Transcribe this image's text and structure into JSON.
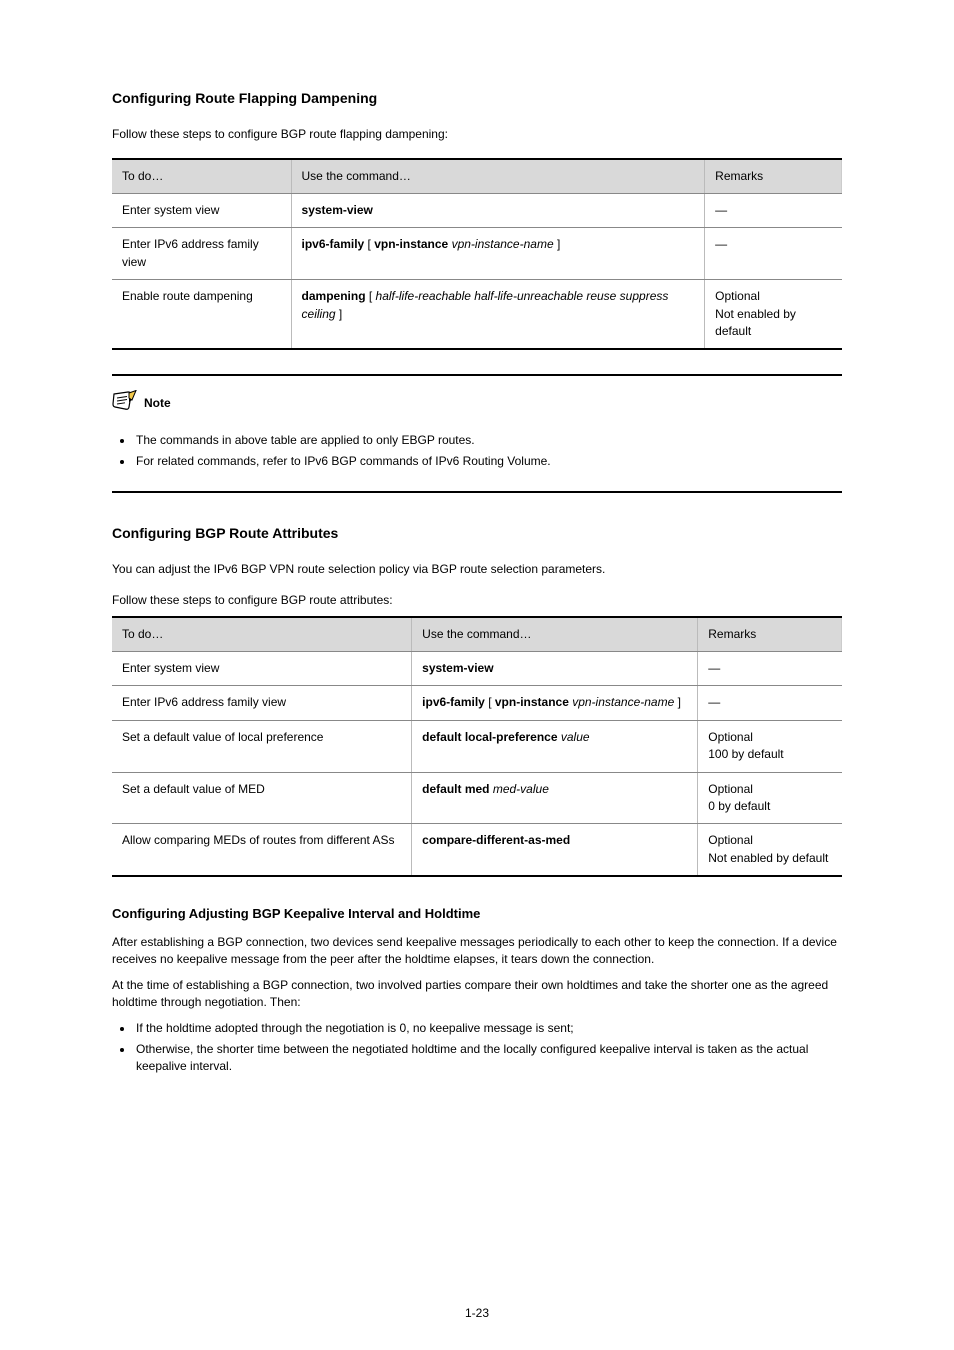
{
  "section1": {
    "title": "Configuring Route Flapping Dampening",
    "intro": "Follow these steps to configure BGP route flapping dampening:",
    "table_caption": "",
    "table": {
      "headers": [
        "To do…",
        "Use the command…",
        "Remarks"
      ],
      "rows": [
        {
          "todo": "Enter system view",
          "cmd_parts": [
            {
              "text": "system-view",
              "style": "cmd"
            }
          ],
          "remarks": "—"
        },
        {
          "todo": "Enter IPv6 address family view",
          "cmd_parts": [
            {
              "text": "ipv6-family ",
              "style": "cmd"
            },
            {
              "text": "[ ",
              "style": "plain"
            },
            {
              "text": "vpn-instance",
              "style": "cmd"
            },
            {
              "text": " vpn-instance-name",
              "style": "arg"
            },
            {
              "text": " ]",
              "style": "plain"
            }
          ],
          "remarks": "—"
        },
        {
          "todo": "Enable route dampening",
          "cmd_parts": [
            {
              "text": "dampening",
              "style": "cmd"
            },
            {
              "text": " [ ",
              "style": "plain"
            },
            {
              "text": "half-life-reachable half-life-unreachable reuse suppress ceiling",
              "style": "arg"
            },
            {
              "text": " ]",
              "style": "plain"
            }
          ],
          "remarks": "Optional\nNot enabled by default"
        }
      ]
    },
    "note": {
      "label": "Note",
      "items": [
        "The commands in above table are applied to only EBGP routes.",
        "For related commands, refer to IPv6 BGP commands of IPv6 Routing Volume."
      ]
    }
  },
  "section2": {
    "title": "Configuring BGP Route Attributes",
    "intro": "You can adjust the IPv6 BGP VPN route selection policy via BGP route selection parameters.",
    "table_caption": "Follow these steps to configure BGP route attributes:",
    "table": {
      "headers": [
        "To do…",
        "Use the command…",
        "Remarks"
      ],
      "rows": [
        {
          "todo": "Enter system view",
          "cmd_parts": [
            {
              "text": "system-view",
              "style": "cmd"
            }
          ],
          "remarks": "—"
        },
        {
          "todo": "Enter IPv6 address family view",
          "cmd_parts": [
            {
              "text": "ipv6-family ",
              "style": "cmd"
            },
            {
              "text": "[ ",
              "style": "plain"
            },
            {
              "text": "vpn-instance",
              "style": "cmd"
            },
            {
              "text": " vpn-instance-name",
              "style": "arg"
            },
            {
              "text": " ]",
              "style": "plain"
            }
          ],
          "remarks": "—"
        },
        {
          "todo": "Set a default value of local preference",
          "cmd_parts": [
            {
              "text": "default local-preference",
              "style": "cmd"
            },
            {
              "text": " value",
              "style": "arg"
            }
          ],
          "remarks": "Optional\n100 by default"
        },
        {
          "todo": "Set a default value of MED",
          "cmd_parts": [
            {
              "text": "default med",
              "style": "cmd"
            },
            {
              "text": " med-value",
              "style": "arg"
            }
          ],
          "remarks": "Optional\n0 by default"
        },
        {
          "todo": "Allow comparing MEDs of routes from different ASs",
          "cmd_parts": [
            {
              "text": "compare-different-as-med",
              "style": "cmd"
            }
          ],
          "remarks": "Optional\nNot enabled by default"
        }
      ]
    },
    "subtitle": "Configuring Adjusting BGP Keepalive Interval and Holdtime",
    "desc1": "After establishing a BGP connection, two devices send keepalive messages periodically to each other to keep the connection. If a device receives no keepalive message from the peer after the holdtime elapses, it tears down the connection.",
    "desc2_lead": "At the time of establishing a BGP connection, two involved parties compare their own holdtimes and take the shorter one as the agreed holdtime through negotiation. Then:",
    "desc2_items": [
      "If the holdtime adopted through the negotiation is 0, no keepalive message is sent;",
      "Otherwise, the shorter time between the negotiated holdtime and the locally configured keepalive interval is taken as the actual keepalive interval."
    ]
  },
  "page_number": "1-23"
}
